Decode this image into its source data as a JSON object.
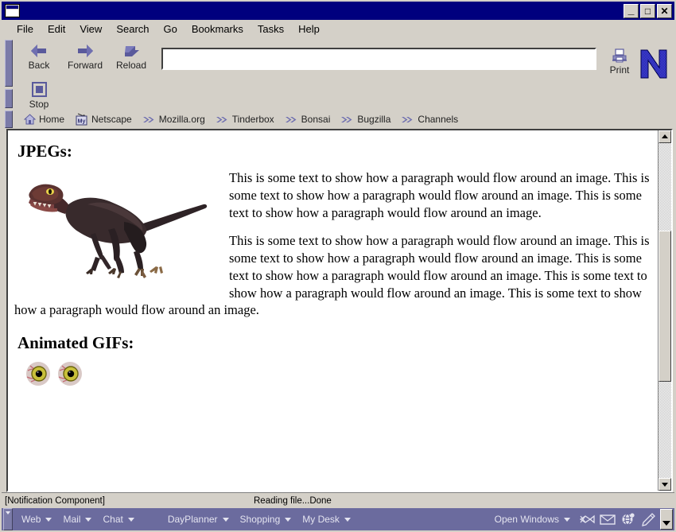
{
  "window": {
    "icon": "window-icon",
    "controls": {
      "minimize": "_",
      "maximize": "□",
      "close": "✕"
    }
  },
  "menubar": {
    "items": [
      {
        "label": "File"
      },
      {
        "label": "Edit"
      },
      {
        "label": "View"
      },
      {
        "label": "Search"
      },
      {
        "label": "Go"
      },
      {
        "label": "Bookmarks"
      },
      {
        "label": "Tasks"
      },
      {
        "label": "Help"
      }
    ]
  },
  "toolbar": {
    "back_label": "Back",
    "forward_label": "Forward",
    "reload_label": "Reload",
    "stop_label": "Stop",
    "print_label": "Print",
    "url_value": "",
    "url_placeholder": "",
    "logo": "netscape-n-logo"
  },
  "bookmarks_bar": {
    "items": [
      {
        "label": "Home",
        "icon": "home-icon"
      },
      {
        "label": "Netscape",
        "icon": "my-netscape-icon"
      },
      {
        "label": "Mozilla.org",
        "icon": "bookmark-chevron-icon"
      },
      {
        "label": "Tinderbox",
        "icon": "bookmark-chevron-icon"
      },
      {
        "label": "Bonsai",
        "icon": "bookmark-chevron-icon"
      },
      {
        "label": "Bugzilla",
        "icon": "bookmark-chevron-icon"
      },
      {
        "label": "Channels",
        "icon": "bookmark-chevron-icon"
      }
    ]
  },
  "page": {
    "heading_jpegs": "JPEGs:",
    "heading_gifs": "Animated GIFs:",
    "paragraph1": "This is some text to show how a paragraph would flow around an image. This is some text to show how a paragraph would flow around an image. This is some text to show how a paragraph would flow around an image.",
    "paragraph2": "This is some text to show how a paragraph would flow around an image. This is some text to show how a paragraph would flow around an image. This is some text to show how a paragraph would flow around an image. This is some text to show how a paragraph would flow around an image. This is some text to show how a paragraph would flow around an image.",
    "dino_image_alt": "mozilla-raptor-dinosaur-image",
    "gif_image_alt": "animated-eyeball-gif"
  },
  "statusbar": {
    "left": "[Notification Component]",
    "center": "Reading file...Done"
  },
  "taskbar": {
    "items": [
      {
        "label": "Web"
      },
      {
        "label": "Mail"
      },
      {
        "label": "Chat"
      }
    ],
    "items2": [
      {
        "label": "DayPlanner"
      },
      {
        "label": "Shopping"
      },
      {
        "label": "My Desk"
      }
    ],
    "open_windows_label": "Open Windows",
    "icons": [
      {
        "name": "mozilla-fish-icon"
      },
      {
        "name": "mail-envelope-icon"
      },
      {
        "name": "browser-globe-icon"
      },
      {
        "name": "composer-pen-icon"
      }
    ]
  },
  "colors": {
    "titlebar": "#00007e",
    "chrome": "#d4d0c8",
    "taskbar": "#6b6b9e",
    "toolbar_icon": "#5a5a9c"
  }
}
